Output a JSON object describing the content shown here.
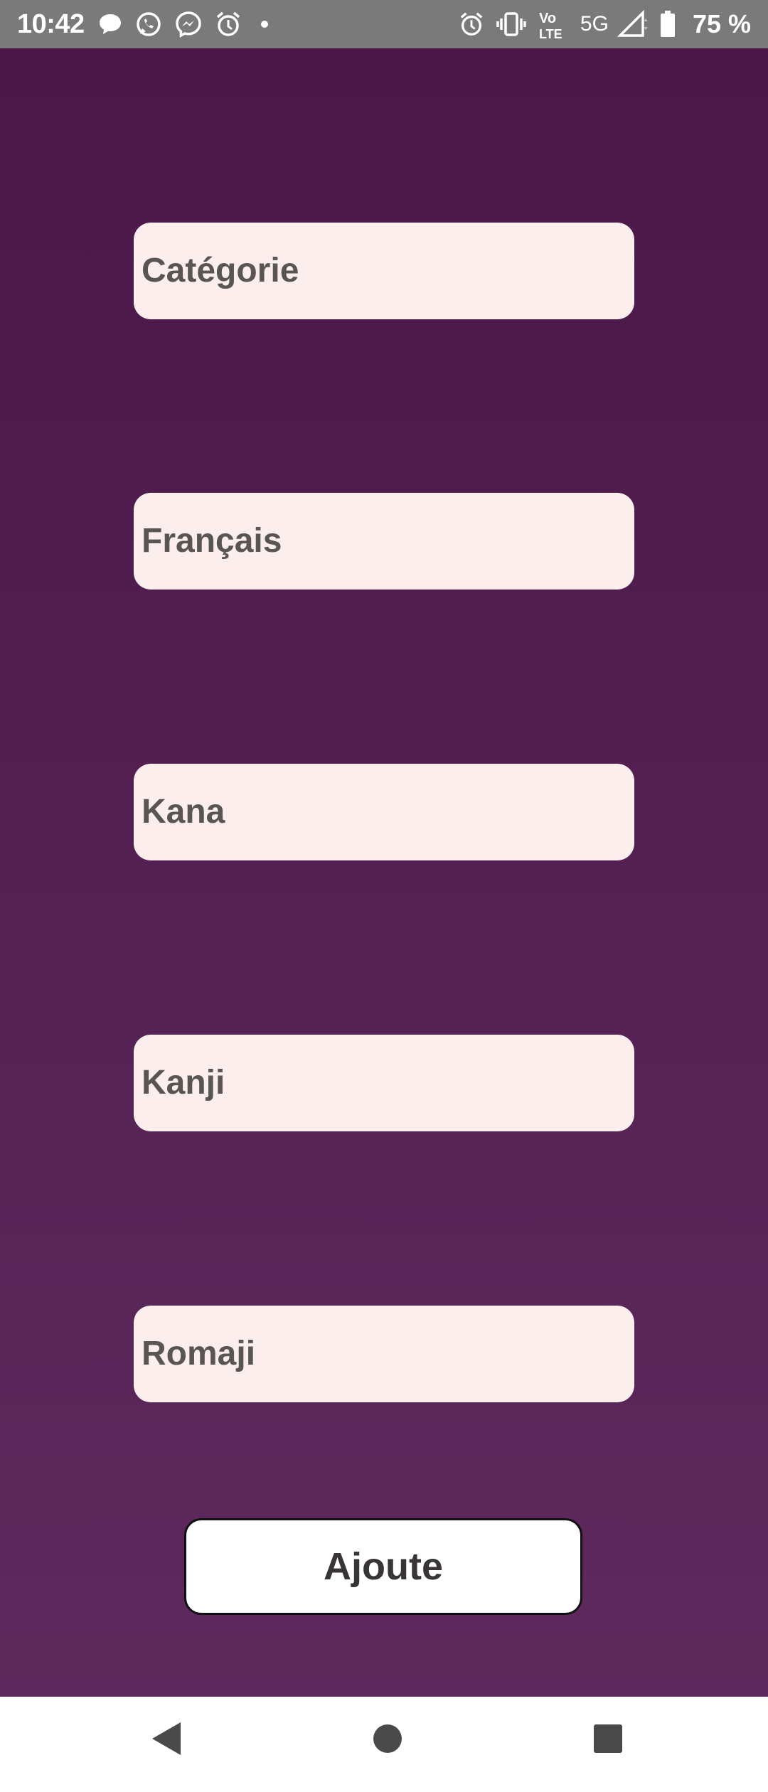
{
  "status_bar": {
    "time": "10:42",
    "left_icons": [
      "chat-bubble-icon",
      "whatsapp-icon",
      "messenger-icon",
      "alarm-clock-icon",
      "dot-icon"
    ],
    "right_icons": [
      "alarm-icon",
      "vibrate-icon",
      "volte-icon",
      "signal-icon",
      "battery-icon"
    ],
    "volte_label": "Vo",
    "lte_label": "LTE",
    "network": "5G",
    "battery": "75 %"
  },
  "form": {
    "fields": [
      {
        "placeholder": "Catégorie"
      },
      {
        "placeholder": "Français"
      },
      {
        "placeholder": "Kana"
      },
      {
        "placeholder": "Kanji"
      },
      {
        "placeholder": "Romaji"
      }
    ],
    "add_button_label": "Ajoute"
  },
  "navigation": {
    "icons": [
      "back-icon",
      "home-icon",
      "recents-icon"
    ]
  },
  "colors": {
    "background_top": "#4a1748",
    "background_bottom": "#5e2a5d",
    "field_background": "#fdeeee",
    "field_text": "#5a5555",
    "status_bar": "#7a7a7a"
  }
}
